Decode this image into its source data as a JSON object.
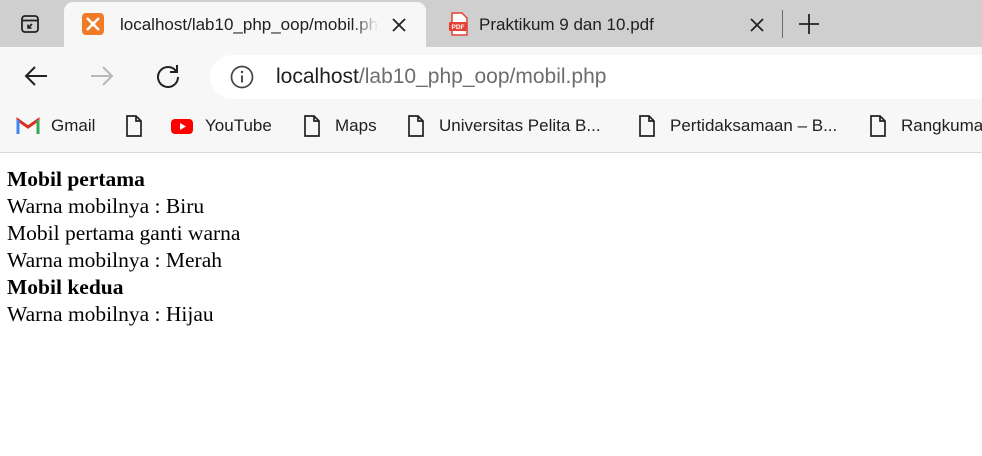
{
  "tabs": [
    {
      "title": "localhost/lab10_php_oop/mobil.php",
      "favicon": "xampp-icon",
      "active": true
    },
    {
      "title": "Praktikum 9 dan 10.pdf",
      "favicon": "pdf-icon",
      "active": false
    }
  ],
  "address_bar": {
    "host": "localhost",
    "path": "/lab10_php_oop/mobil.php"
  },
  "bookmarks": [
    {
      "label": "Gmail",
      "icon": "gmail-icon"
    },
    {
      "label": "",
      "icon": "page-icon"
    },
    {
      "label": "YouTube",
      "icon": "youtube-icon"
    },
    {
      "label": "Maps",
      "icon": "page-icon"
    },
    {
      "label": "Universitas Pelita B...",
      "icon": "page-icon"
    },
    {
      "label": "Pertidaksamaan – B...",
      "icon": "page-icon"
    },
    {
      "label": "Rangkuma",
      "icon": "page-icon"
    }
  ],
  "content": {
    "line1": "Mobil pertama",
    "line2": "Warna mobilnya : Biru",
    "line3": "Mobil pertama ganti warna",
    "line4": "Warna mobilnya : Merah",
    "line5": "Mobil kedua",
    "line6": "Warna mobilnya : Hijau"
  },
  "colors": {
    "tabstrip": "#cfcfcf",
    "toolbar": "#f7f7f7",
    "xampp": "#f07b27",
    "pdf": "#e34234",
    "youtube": "#ff0000"
  }
}
